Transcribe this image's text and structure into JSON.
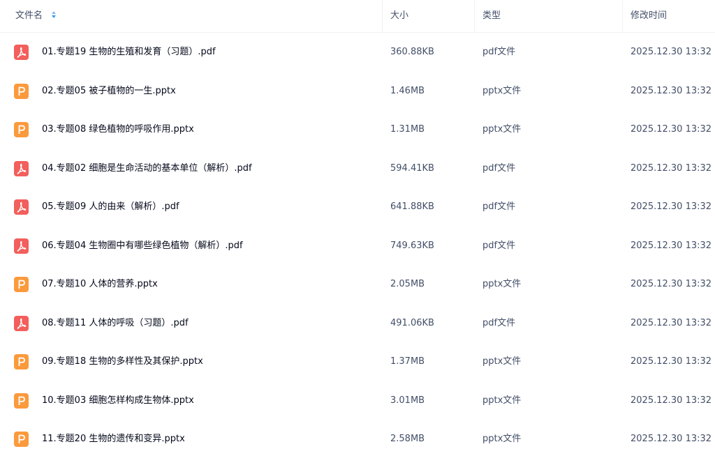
{
  "header": {
    "name_label": "文件名",
    "size_label": "大小",
    "type_label": "类型",
    "modified_label": "修改时间"
  },
  "colors": {
    "pdf": "#f25f5c",
    "pptx": "#fb9a3c",
    "sort_up": "#8fb8f2",
    "sort_down": "#25a0f5"
  },
  "files": [
    {
      "name": "01.专题19 生物的生殖和发育（习题）.pdf",
      "size": "360.88KB",
      "type": "pdf文件",
      "modified": "2025.12.30 13:32",
      "icon": "pdf-icon"
    },
    {
      "name": "02.专题05 被子植物的一生.pptx",
      "size": "1.46MB",
      "type": "pptx文件",
      "modified": "2025.12.30 13:32",
      "icon": "pptx-icon"
    },
    {
      "name": "03.专题08 绿色植物的呼吸作用.pptx",
      "size": "1.31MB",
      "type": "pptx文件",
      "modified": "2025.12.30 13:32",
      "icon": "pptx-icon"
    },
    {
      "name": "04.专题02 细胞是生命活动的基本单位（解析）.pdf",
      "size": "594.41KB",
      "type": "pdf文件",
      "modified": "2025.12.30 13:32",
      "icon": "pdf-icon"
    },
    {
      "name": "05.专题09 人的由来（解析）.pdf",
      "size": "641.88KB",
      "type": "pdf文件",
      "modified": "2025.12.30 13:32",
      "icon": "pdf-icon"
    },
    {
      "name": "06.专题04 生物圈中有哪些绿色植物（解析）.pdf",
      "size": "749.63KB",
      "type": "pdf文件",
      "modified": "2025.12.30 13:32",
      "icon": "pdf-icon"
    },
    {
      "name": "07.专题10 人体的营养.pptx",
      "size": "2.05MB",
      "type": "pptx文件",
      "modified": "2025.12.30 13:32",
      "icon": "pptx-icon"
    },
    {
      "name": "08.专题11 人体的呼吸（习题）.pdf",
      "size": "491.06KB",
      "type": "pdf文件",
      "modified": "2025.12.30 13:32",
      "icon": "pdf-icon"
    },
    {
      "name": "09.专题18 生物的多样性及其保护.pptx",
      "size": "1.37MB",
      "type": "pptx文件",
      "modified": "2025.12.30 13:32",
      "icon": "pptx-icon"
    },
    {
      "name": "10.专题03 细胞怎样构成生物体.pptx",
      "size": "3.01MB",
      "type": "pptx文件",
      "modified": "2025.12.30 13:32",
      "icon": "pptx-icon"
    },
    {
      "name": "11.专题20 生物的遗传和变异.pptx",
      "size": "2.58MB",
      "type": "pptx文件",
      "modified": "2025.12.30 13:32",
      "icon": "pptx-icon"
    }
  ]
}
